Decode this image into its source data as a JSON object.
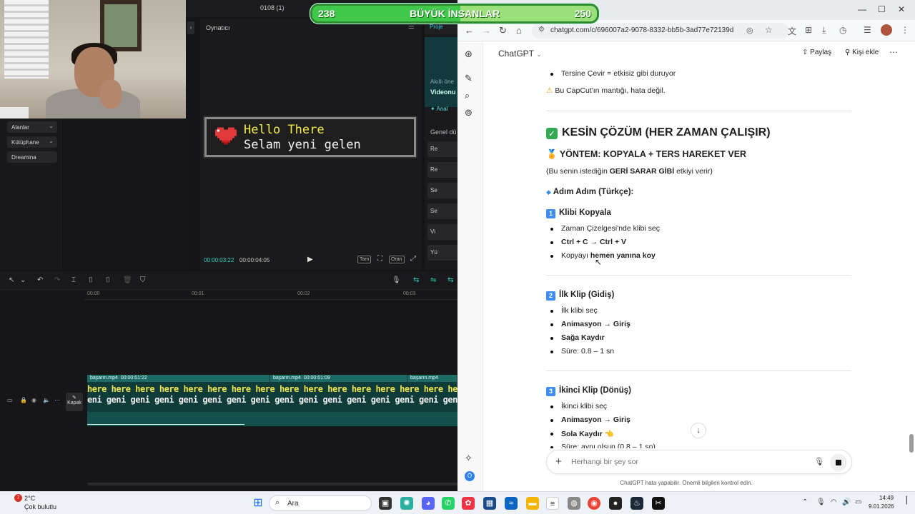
{
  "overlay": {
    "left_value": "238",
    "title": "BÜYÜK İNSANLAR",
    "right_value": "250",
    "progress": 0.52
  },
  "capcut": {
    "title": "0108 (1)",
    "nav": [
      {
        "label": "Alanlar",
        "has_chevron": true
      },
      {
        "label": "Kütüphane",
        "has_chevron": true
      },
      {
        "label": "Dreamina",
        "has_chevron": false
      }
    ],
    "player": {
      "label": "Oynatıcı",
      "line1": "Hello There",
      "line2": "Selam yeni gelen",
      "current_time": "00:00:03:22",
      "total_time": "00:00:04:05",
      "ctrl_tam": "Tam",
      "ctrl_oran": "Oran"
    },
    "right": {
      "tab": "Proje",
      "txt1": "Akıllı öne",
      "txt2": "Videonu",
      "txt3": "✦ Anal",
      "section": "Genel dü",
      "items": [
        "Re",
        "Re",
        "Se",
        "Se",
        "Vi",
        "Yü"
      ]
    },
    "timeline": {
      "ruler": [
        "00:00",
        "00:01",
        "00:02",
        "00:03"
      ],
      "kapak": "Kapak",
      "clips": [
        {
          "name": "başarın.mp4",
          "duration": "00:00:01:22"
        },
        {
          "name": "başarın.mp4",
          "duration": "00:00:01:09"
        },
        {
          "name": "başarın.mp4",
          "duration": ""
        }
      ],
      "strip_row1": "here here here here here here here here here here here here here here here here",
      "strip_row2": "eni geni geni geni geni geni geni geni geni geni geni geni geni geni geni geni"
    }
  },
  "browser": {
    "url": "chatgpt.com/c/696007a2-9078-8332-bb5b-3ad77e72139d",
    "model": "ChatGPT",
    "share": "Paylaş",
    "add_person": "Kişi ekle",
    "chat": {
      "top_bullet": "Tersine Çevir = etkisiz gibi duruyor",
      "warning": "Bu CapCut'ın mantığı, hata değil.",
      "heading": "KESİN ÇÖZÜM (HER ZAMAN ÇALIŞIR)",
      "method": "YÖNTEM: KOPYALA + TERS HAREKET VER",
      "subtitle_pre": "(Bu senin istediğin ",
      "subtitle_bold": "GERİ SARAR GİBİ",
      "subtitle_post": " etkiyi verir)",
      "steps_title": "Adım Adım (Türkçe):",
      "s1_title": "Klibi Kopyala",
      "s1_b1": "Zaman Çizelgesi'nde klibi seç",
      "s1_b2": "Ctrl + C → Ctrl + V",
      "s1_b3_pre": "Kopyayı ",
      "s1_b3_bold": "hemen yanına koy",
      "s2_title": "İlk Klip (Gidiş)",
      "s2_b1": "İlk klibi seç",
      "s2_b2": "Animasyon → Giriş",
      "s2_b3": "Sağa Kaydır",
      "s2_b4": "Süre: 0.8 – 1 sn",
      "s3_title": "İkinci Klip (Dönüş)",
      "s3_b1": "İkinci klibi seç",
      "s3_b2": "Animasyon → Giriş",
      "s3_b3": "Sola Kaydır 👈",
      "s3_b4": "Süre: aynı olsun (0.8 – 1 sn)",
      "n1": "1",
      "n2": "2",
      "n3": "3"
    },
    "composer_placeholder": "Herhangi bir şey sor",
    "disclaimer": "ChatGPT hata yapabilir. Önemli bilgileri kontrol edin.",
    "rail_avatar": "Ö"
  },
  "taskbar": {
    "weather_badge": "7",
    "temp": "2°C",
    "desc": "Çok bulutlu",
    "search": "Ara",
    "time": "14:49",
    "date": "9.01.2026"
  }
}
